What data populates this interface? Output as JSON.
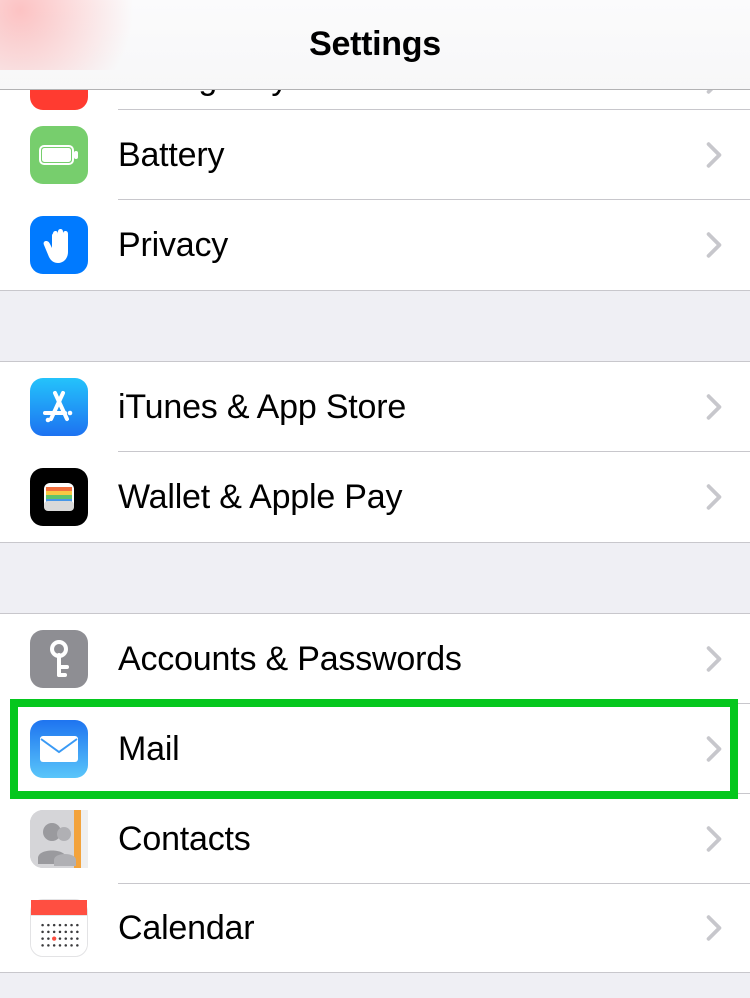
{
  "header": {
    "title": "Settings"
  },
  "groups": {
    "g0": {
      "emergency_sos": {
        "label": "Emergency SOS"
      },
      "battery": {
        "label": "Battery"
      },
      "privacy": {
        "label": "Privacy"
      }
    },
    "g1": {
      "itunes": {
        "label": "iTunes & App Store"
      },
      "wallet": {
        "label": "Wallet & Apple Pay"
      }
    },
    "g2": {
      "accounts": {
        "label": "Accounts & Passwords"
      },
      "mail": {
        "label": "Mail"
      },
      "contacts": {
        "label": "Contacts"
      },
      "calendar": {
        "label": "Calendar"
      }
    }
  },
  "highlighted": "mail",
  "icon_colors": {
    "sos": "#ff3b30",
    "battery": "#77ce6d",
    "privacy": "#007aff",
    "itunes": "#21a6f8",
    "wallet": "#000000",
    "accounts": "#8e8e93",
    "mail_top": "#1e74f0",
    "mail_bot": "#5ac6fa",
    "contacts": "#b8b8bc",
    "calendar_top": "#ff4f41"
  }
}
